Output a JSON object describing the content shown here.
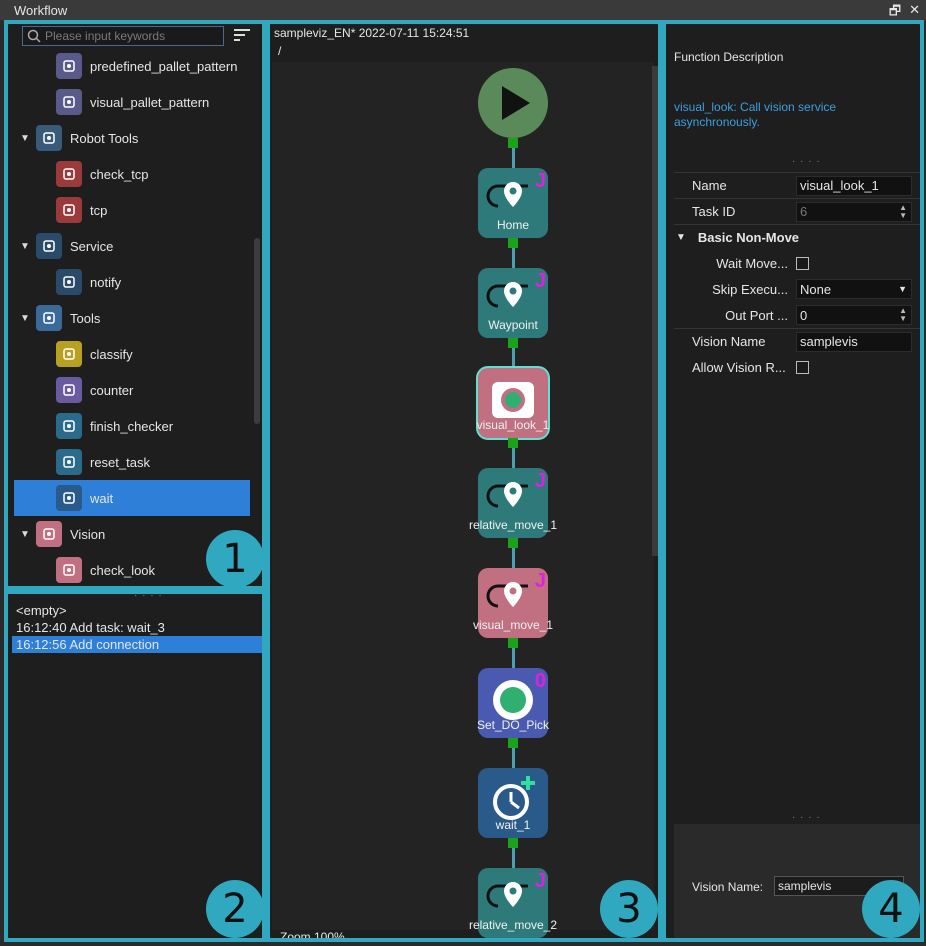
{
  "window": {
    "title": "Workflow",
    "restore_glyph": "🗗",
    "close_glyph": "✕"
  },
  "palette": {
    "search_placeholder": "Please input keywords",
    "items": [
      {
        "label": "predefined_pallet_pattern",
        "level": "child",
        "icon": "pallet-pattern-icon",
        "color": "#5a5a8a"
      },
      {
        "label": "visual_pallet_pattern",
        "level": "child",
        "icon": "visual-pallet-icon",
        "color": "#5a5a8a"
      },
      {
        "label": "Robot Tools",
        "level": "parent",
        "icon": "robot-arm-icon",
        "color": "#3a5a7a"
      },
      {
        "label": "check_tcp",
        "level": "child",
        "icon": "check-tcp-icon",
        "color": "#9a3a3a"
      },
      {
        "label": "tcp",
        "level": "child",
        "icon": "tcp-icon",
        "color": "#9a3a3a"
      },
      {
        "label": "Service",
        "level": "parent",
        "icon": "service-icon",
        "color": "#2a4a6a"
      },
      {
        "label": "notify",
        "level": "child",
        "icon": "notify-icon",
        "color": "#2a4a6a"
      },
      {
        "label": "Tools",
        "level": "parent",
        "icon": "toolbox-icon",
        "color": "#3a6a9a"
      },
      {
        "label": "classify",
        "level": "child",
        "icon": "classify-icon",
        "color": "#b8a020"
      },
      {
        "label": "counter",
        "level": "child",
        "icon": "counter-icon",
        "color": "#6a5aa0"
      },
      {
        "label": "finish_checker",
        "level": "child",
        "icon": "finish-checker-icon",
        "color": "#2a6a8a"
      },
      {
        "label": "reset_task",
        "level": "child",
        "icon": "reset-icon",
        "color": "#2a6a8a"
      },
      {
        "label": "wait",
        "level": "child",
        "icon": "wait-clock-icon",
        "color": "#2a5a8a",
        "selected": true
      },
      {
        "label": "Vision",
        "level": "parent",
        "icon": "camera-icon",
        "color": "#c07080"
      },
      {
        "label": "check_look",
        "level": "child",
        "icon": "check-look-icon",
        "color": "#c07080"
      }
    ]
  },
  "history": {
    "entries": [
      {
        "text": "<empty>"
      },
      {
        "text": "16:12:40 Add task: wait_3"
      },
      {
        "text": "16:12:56 Add connection",
        "selected": true
      }
    ]
  },
  "canvas": {
    "header": "sampleviz_EN* 2022-07-11 15:24:51",
    "path": "/",
    "zoom": "Zoom 100%",
    "nodes": [
      {
        "label": "",
        "kind": "start",
        "icon": "play-icon",
        "color": "#5a8a5a"
      },
      {
        "label": "Home",
        "kind": "move",
        "icon": "waypoint-icon",
        "color": "#2e7a7a",
        "badge": "J"
      },
      {
        "label": "Waypoint",
        "kind": "move",
        "icon": "waypoint-icon",
        "color": "#2e7a7a",
        "badge": "J"
      },
      {
        "label": "visual_look_1",
        "kind": "vision",
        "icon": "camera-icon",
        "color": "#c07080",
        "selected": true
      },
      {
        "label": "relative_move_1",
        "kind": "move",
        "icon": "relative-move-icon",
        "color": "#2e7a7a",
        "badge": "J"
      },
      {
        "label": "visual_move_1",
        "kind": "move",
        "icon": "visual-move-icon",
        "color": "#c07080",
        "badge": "J"
      },
      {
        "label": "Set_DO_Pick",
        "kind": "do",
        "icon": "digital-out-icon",
        "color": "#4a5ab0",
        "badge": "0"
      },
      {
        "label": "wait_1",
        "kind": "wait",
        "icon": "wait-clock-icon",
        "color": "#2a5a8a"
      },
      {
        "label": "relative_move_2",
        "kind": "move",
        "icon": "relative-move-icon",
        "color": "#2e7a7a",
        "badge": "J"
      }
    ]
  },
  "properties": {
    "function_description_title": "Function Description",
    "description": "visual_look: Call vision service asynchronously.",
    "name_label": "Name",
    "name_value": "visual_look_1",
    "task_id_label": "Task ID",
    "task_id_value": "6",
    "group_label": "Basic Non-Move",
    "wait_move_label": "Wait Move...",
    "skip_exec_label": "Skip Execu...",
    "skip_exec_value": "None",
    "out_port_label": "Out Port ...",
    "out_port_value": "0",
    "vision_name_label": "Vision Name",
    "vision_name_value": "samplevis",
    "allow_vision_label": "Allow Vision R...",
    "bottom_vision_label": "Vision Name:",
    "bottom_vision_value": "samplevis"
  },
  "badges": [
    "1",
    "2",
    "3",
    "4"
  ],
  "colors": {
    "accent": "#2fa8c0",
    "selection": "#2d7fd8",
    "link": "#3aa0e0",
    "port": "#1aa31a",
    "badge_text": "#e020e0"
  }
}
